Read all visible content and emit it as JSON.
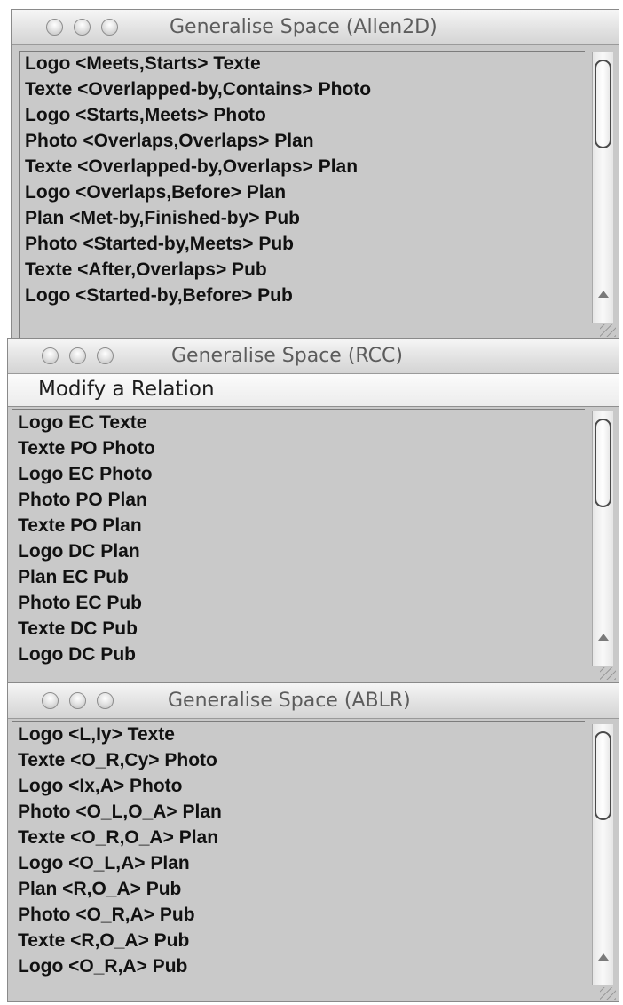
{
  "windows": [
    {
      "title": "Generalise Space (Allen2D)",
      "rows": [
        "Logo <Meets,Starts> Texte",
        "Texte <Overlapped-by,Contains> Photo",
        "Logo <Starts,Meets> Photo",
        "Photo <Overlaps,Overlaps> Plan",
        "Texte <Overlapped-by,Overlaps> Plan",
        "Logo <Overlaps,Before> Plan",
        "Plan <Met-by,Finished-by> Pub",
        "Photo <Started-by,Meets> Pub",
        "Texte <After,Overlaps> Pub",
        "Logo <Started-by,Before> Pub"
      ]
    },
    {
      "title": "Generalise Space (RCC)",
      "menu": {
        "item": "Modify a Relation"
      },
      "rows": [
        "Logo EC Texte",
        "Texte PO Photo",
        "Logo EC Photo",
        "Photo PO Plan",
        "Texte PO Plan",
        "Logo DC Plan",
        "Plan EC Pub",
        "Photo EC Pub",
        "Texte DC Pub",
        "Logo DC Pub"
      ]
    },
    {
      "title": "Generalise Space (ABLR)",
      "rows": [
        "Logo <L,Iy> Texte",
        "Texte <O_R,Cy> Photo",
        "Logo <Ix,A> Photo",
        "Photo <O_L,O_A> Plan",
        "Texte <O_R,O_A> Plan",
        "Logo <O_L,A> Plan",
        "Plan <R,O_A> Pub",
        "Photo <O_R,A> Pub",
        "Texte <R,O_A> Pub",
        "Logo <O_R,A> Pub"
      ]
    }
  ]
}
